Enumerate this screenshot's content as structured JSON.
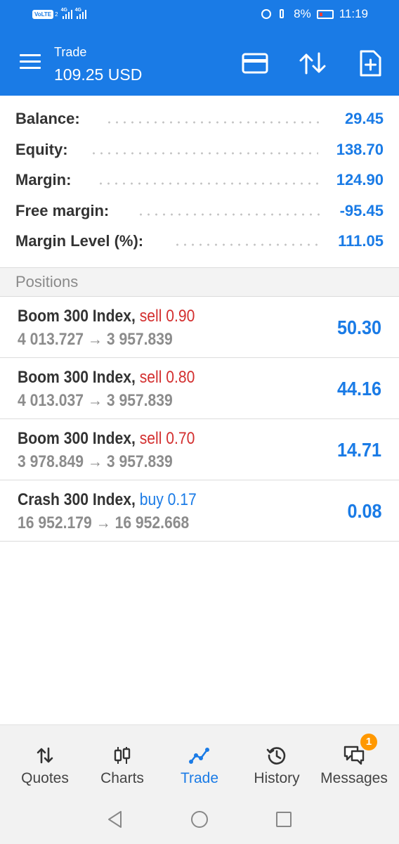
{
  "status_bar": {
    "volte": "VoLTE",
    "sim_slot": "2",
    "network1": "4G",
    "network2": "4G",
    "battery": "8%",
    "time": "11:19"
  },
  "app_bar": {
    "title": "Trade",
    "subtitle": "109.25 USD",
    "icons": [
      "menu-icon",
      "card-icon",
      "sort-icon",
      "new-order-icon"
    ]
  },
  "summary": [
    {
      "label": "Balance:",
      "value": "29.45"
    },
    {
      "label": "Equity:",
      "value": "138.70"
    },
    {
      "label": "Margin:",
      "value": "124.90"
    },
    {
      "label": "Free margin:",
      "value": "-95.45"
    },
    {
      "label": "Margin Level (%):",
      "value": "111.05"
    }
  ],
  "positions_header": "Positions",
  "positions": [
    {
      "symbol": "Boom 300 Index,",
      "side": "sell",
      "volume": "0.90",
      "open": "4 013.727",
      "arrow": "→",
      "current": "3 957.839",
      "profit": "50.30"
    },
    {
      "symbol": "Boom 300 Index,",
      "side": "sell",
      "volume": "0.80",
      "open": "4 013.037",
      "arrow": "→",
      "current": "3 957.839",
      "profit": "44.16"
    },
    {
      "symbol": "Boom 300 Index,",
      "side": "sell",
      "volume": "0.70",
      "open": "3 978.849",
      "arrow": "→",
      "current": "3 957.839",
      "profit": "14.71"
    },
    {
      "symbol": "Crash 300 Index,",
      "side": "buy",
      "volume": "0.17",
      "open": "16 952.179",
      "arrow": "→",
      "current": "16 952.668",
      "profit": "0.08"
    }
  ],
  "bottom_nav": [
    {
      "label": "Quotes",
      "icon": "quotes-icon",
      "active": false
    },
    {
      "label": "Charts",
      "icon": "charts-icon",
      "active": false
    },
    {
      "label": "Trade",
      "icon": "trade-icon",
      "active": true
    },
    {
      "label": "History",
      "icon": "history-icon",
      "active": false
    },
    {
      "label": "Messages",
      "icon": "messages-icon",
      "active": false,
      "badge": "1"
    }
  ],
  "colors": {
    "primary": "#1a7be6",
    "sell": "#d32f2f",
    "badge": "#ff9800"
  }
}
